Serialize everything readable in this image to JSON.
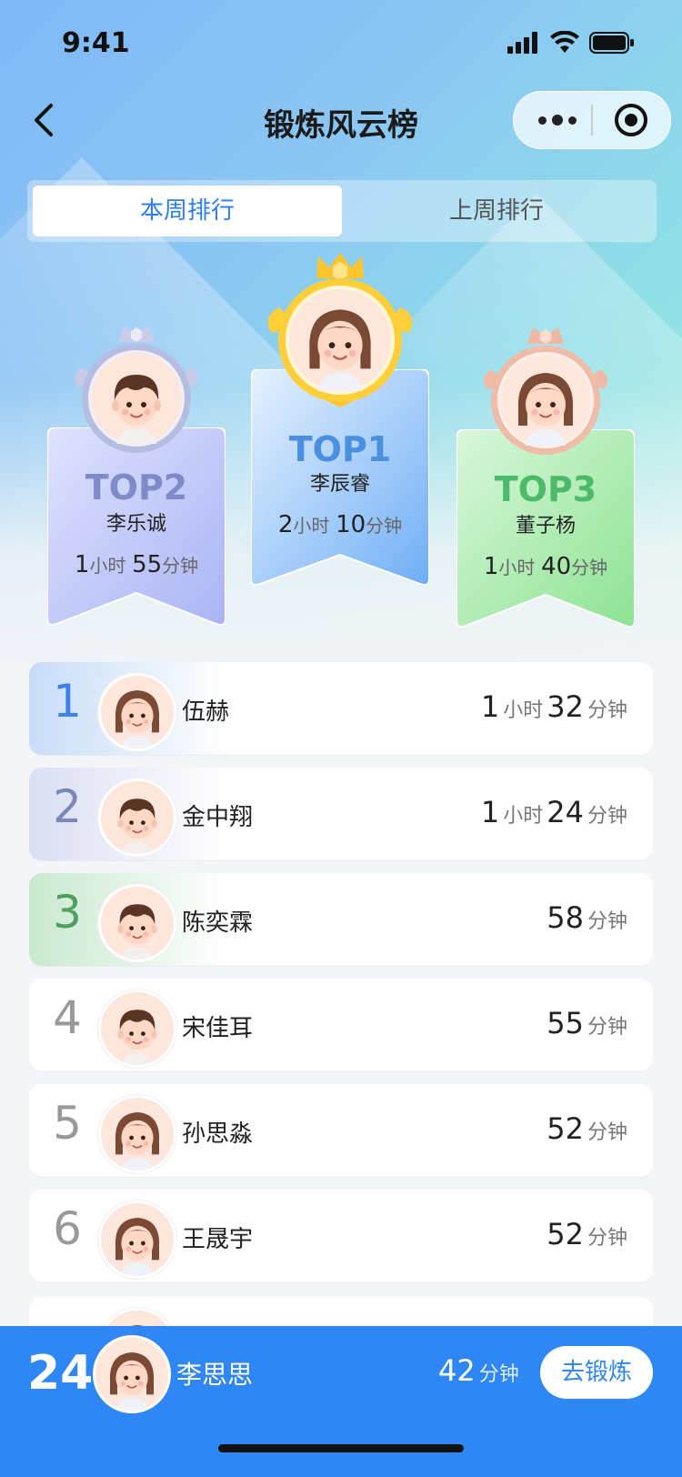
{
  "status_bar": {
    "time": "9:41"
  },
  "nav": {
    "title": "锻炼风云榜"
  },
  "tabs": {
    "active": "本周排行",
    "inactive": "上周排行"
  },
  "podium": {
    "top1": {
      "label": "TOP1",
      "name": "李辰睿",
      "hours": "2",
      "hours_unit": "小时",
      "minutes": "10",
      "minutes_unit": "分钟",
      "color": "#4a8fe0"
    },
    "top2": {
      "label": "TOP2",
      "name": "李乐诚",
      "hours": "1",
      "hours_unit": "小时",
      "minutes": "55",
      "minutes_unit": "分钟",
      "color": "#7f8bc8"
    },
    "top3": {
      "label": "TOP3",
      "name": "董子杨",
      "hours": "1",
      "hours_unit": "小时",
      "minutes": "40",
      "minutes_unit": "分钟",
      "color": "#4dba6a"
    }
  },
  "list": [
    {
      "rank": "1",
      "name": "伍赫",
      "hours": "1",
      "hours_unit": "小时",
      "minutes": "32",
      "minutes_unit": "分钟",
      "avatar": "girl"
    },
    {
      "rank": "2",
      "name": "金中翔",
      "hours": "1",
      "hours_unit": "小时",
      "minutes": "24",
      "minutes_unit": "分钟",
      "avatar": "boy"
    },
    {
      "rank": "3",
      "name": "陈奕霖",
      "hours": "",
      "hours_unit": "",
      "minutes": "58",
      "minutes_unit": "分钟",
      "avatar": "boy"
    },
    {
      "rank": "4",
      "name": "宋佳耳",
      "hours": "",
      "hours_unit": "",
      "minutes": "55",
      "minutes_unit": "分钟",
      "avatar": "boy"
    },
    {
      "rank": "5",
      "name": "孙思淼",
      "hours": "",
      "hours_unit": "",
      "minutes": "52",
      "minutes_unit": "分钟",
      "avatar": "girl"
    },
    {
      "rank": "6",
      "name": "王晟宇",
      "hours": "",
      "hours_unit": "",
      "minutes": "52",
      "minutes_unit": "分钟",
      "avatar": "girl"
    }
  ],
  "me": {
    "rank": "24",
    "name": "李思思",
    "minutes": "42",
    "minutes_unit": "分钟",
    "action": "去锻炼"
  },
  "colors": {
    "accent": "#2f86f5",
    "rank1": "#3b82e6",
    "rank2": "#7c87b8",
    "rank3": "#4f9e62",
    "rank_other": "#999999"
  }
}
